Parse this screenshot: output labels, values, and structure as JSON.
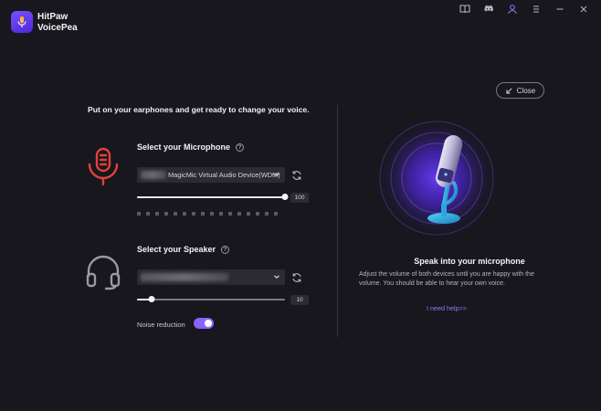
{
  "app": {
    "name_line1": "HitPaw",
    "name_line2": "VoicePea"
  },
  "topbar": {
    "icons": [
      "book-icon",
      "discord-icon",
      "user-icon",
      "menu-icon",
      "minimize-icon",
      "close-window-icon"
    ]
  },
  "close_button": {
    "label": "Close"
  },
  "headline": "Put on your earphones and get ready to change your voice.",
  "microphone": {
    "title": "Select your Microphone",
    "selected_device": "MagicMic Virtual Audio Device(WDM)",
    "volume": 100,
    "volume_label": "100",
    "level_segments": 16
  },
  "speaker": {
    "title": "Select your Speaker",
    "volume": 10,
    "volume_label": "10"
  },
  "noise_reduction": {
    "label": "Noise reduction",
    "enabled": true
  },
  "hero": {
    "title": "Speak into your microphone",
    "description": "Adjust the volume of both devices until you are happy with the volume. You should be able to hear your own voice.",
    "help_link": "I need help>>"
  },
  "colors": {
    "background": "#17171d",
    "accent": "#8a63ff",
    "mic_icon": "#e0413c",
    "link": "#8a7cff"
  }
}
